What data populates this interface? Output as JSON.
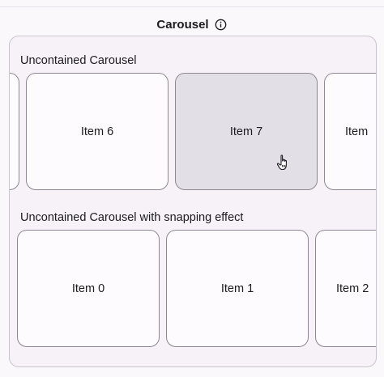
{
  "header": {
    "title": "Carousel",
    "info_icon": "info-icon"
  },
  "uncontained": {
    "title": "Uncontained Carousel",
    "items": [
      {
        "label": ""
      },
      {
        "label": "Item 6"
      },
      {
        "label": "Item 7",
        "hovered": true
      },
      {
        "label": "Item"
      }
    ]
  },
  "snapping": {
    "title": "Uncontained Carousel with snapping effect",
    "items": [
      {
        "label": "Item 0"
      },
      {
        "label": "Item 1"
      },
      {
        "label": "Item 2"
      }
    ]
  },
  "colors": {
    "background": "#fbf8fc",
    "panel": "#f6f2f7",
    "card": "#fdfbfe",
    "card_hover": "#e3dfe7",
    "outline": "#8c8792"
  },
  "cursor": "pointer-hand-icon"
}
